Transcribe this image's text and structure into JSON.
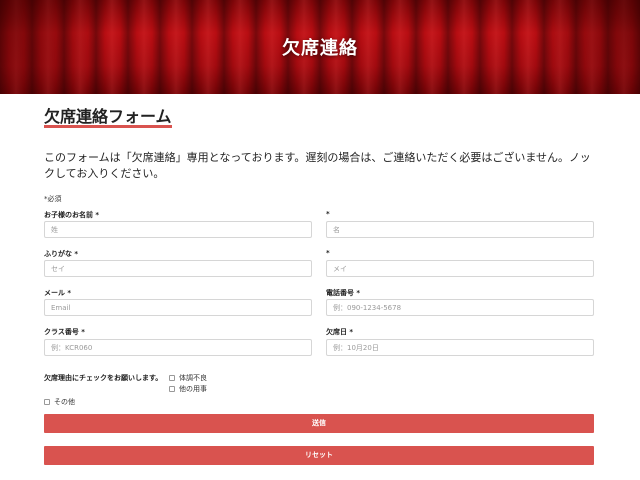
{
  "hero": {
    "title": "欠席連絡"
  },
  "form": {
    "heading": "欠席連絡フォーム",
    "intro": "このフォームは「欠席連絡」専用となっております。遅刻の場合は、ご連絡いただく必要はございません。ノックしてお入りください。",
    "required_note": "*必須",
    "fields": {
      "child_name": {
        "label": "お子様のお名前 *",
        "last_placeholder": "姓",
        "first_label": "*",
        "first_placeholder": "名"
      },
      "furigana": {
        "label": "ふりがな *",
        "last_placeholder": "セイ",
        "first_label": "*",
        "first_placeholder": "メイ"
      },
      "email": {
        "label": "メール *",
        "placeholder": "Email"
      },
      "phone": {
        "label": "電話番号 *",
        "placeholder": "例：090-1234-5678"
      },
      "class_no": {
        "label": "クラス番号 *",
        "placeholder": "例：KCR060"
      },
      "absence_date": {
        "label": "欠席日 *",
        "placeholder": "例：10月20日"
      }
    },
    "reason": {
      "label": "欠席理由にチェックをお願いします。",
      "options": [
        "体調不良",
        "他の用事",
        "その他"
      ]
    },
    "submit_label": "送信",
    "reset_label": "リセット"
  },
  "colors": {
    "accent": "#d9534f",
    "curtain": "#b80d12"
  }
}
